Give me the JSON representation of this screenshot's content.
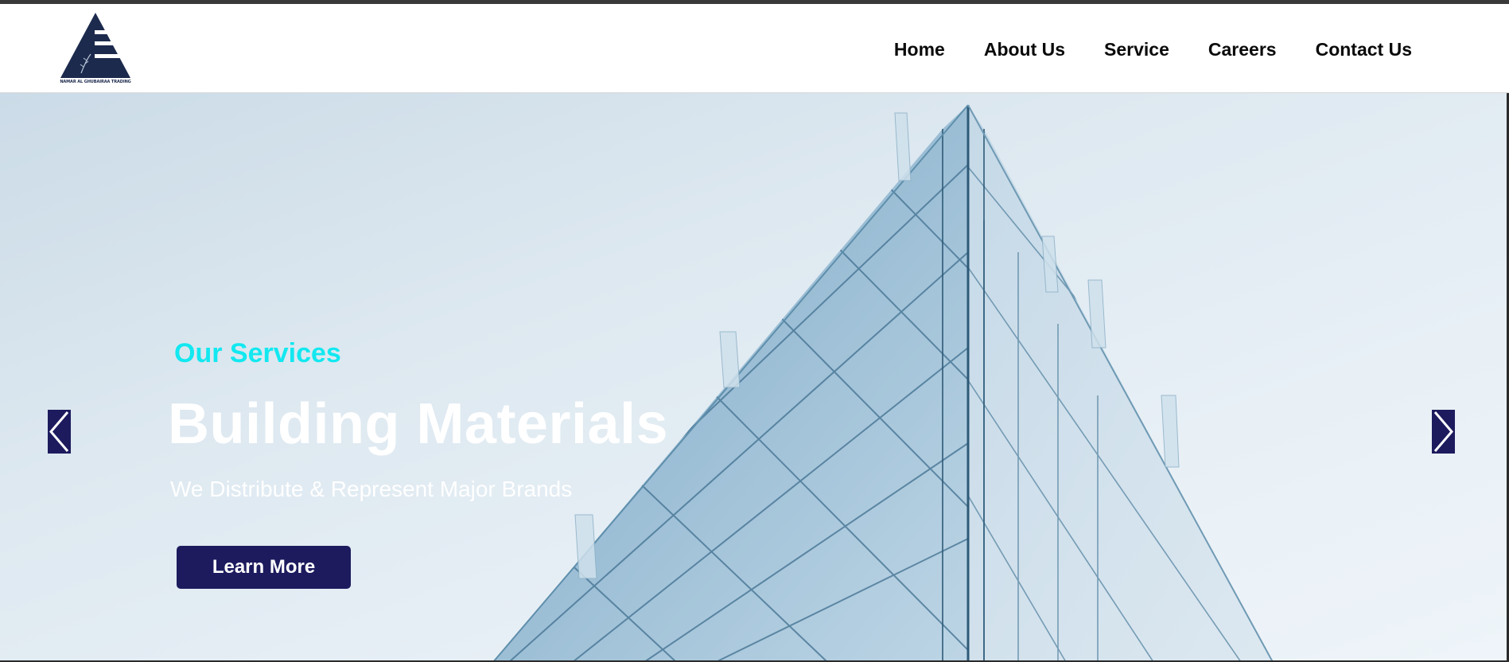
{
  "brand": {
    "logo_text": "NAMAR AL GHUBAIRAA TRADING",
    "logo_color": "#1c2a4d"
  },
  "nav": {
    "items": [
      {
        "label": "Home"
      },
      {
        "label": "About Us"
      },
      {
        "label": "Service"
      },
      {
        "label": "Careers"
      },
      {
        "label": "Contact Us"
      }
    ]
  },
  "hero": {
    "eyebrow": "Our Services",
    "headline": "Building Materials",
    "subtitle": "We Distribute & Represent Major Brands",
    "cta_label": "Learn More",
    "accent_color": "#12e8f0",
    "button_color": "#1d1b5e",
    "prev_icon": "chevron-left-icon",
    "next_icon": "chevron-right-icon"
  }
}
